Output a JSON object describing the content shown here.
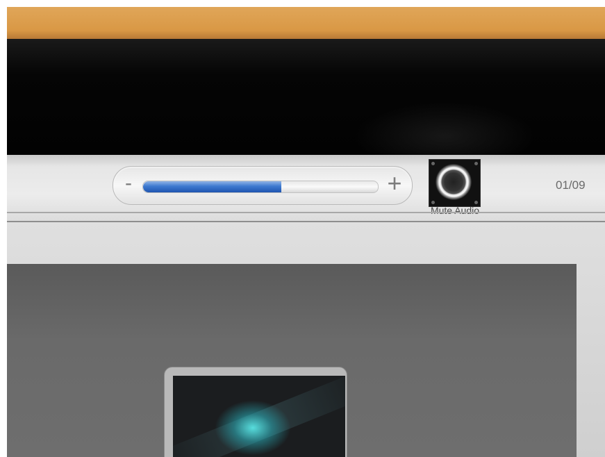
{
  "volume": {
    "minus_label": "-",
    "plus_label": "+",
    "level_percent": 59,
    "fill_color": "#2f67c2"
  },
  "mute": {
    "icon": "speaker-icon",
    "label": "Mute Audio"
  },
  "page_counter": "01/09",
  "colors": {
    "desk": "#d99845",
    "bezel": "#050505",
    "toolbar": "#e6e6e6",
    "stage": "#646464",
    "thumb_glow": "#3fc8cc"
  }
}
